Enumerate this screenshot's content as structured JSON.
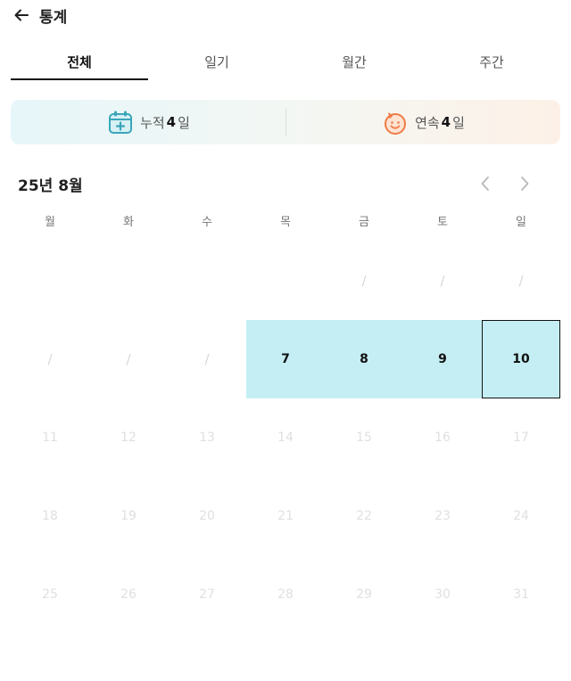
{
  "header": {
    "title": "통계"
  },
  "tabs": [
    {
      "label": "전체"
    },
    {
      "label": "일기"
    },
    {
      "label": "월간"
    },
    {
      "label": "주간"
    }
  ],
  "stats": {
    "cumulative": {
      "label": "누적",
      "value": "4",
      "unit": "일",
      "icon": "calendar-add-icon"
    },
    "streak": {
      "label": "연속",
      "value": "4",
      "unit": "일",
      "icon": "smiley-face-icon"
    }
  },
  "calendar": {
    "month_label": "25년 8월",
    "weekdays": [
      "월",
      "화",
      "수",
      "목",
      "금",
      "토",
      "일"
    ],
    "rows": [
      [
        "",
        "",
        "",
        "",
        "/",
        "/",
        "/"
      ],
      [
        "/",
        "/",
        "/",
        "7",
        "8",
        "9",
        "10"
      ],
      [
        "11",
        "12",
        "13",
        "14",
        "15",
        "16",
        "17"
      ],
      [
        "18",
        "19",
        "20",
        "21",
        "22",
        "23",
        "24"
      ],
      [
        "25",
        "26",
        "27",
        "28",
        "29",
        "30",
        "31"
      ]
    ],
    "active_days": [
      "7",
      "8",
      "9",
      "10"
    ],
    "today": "10"
  },
  "colors": {
    "highlight": "#c5eef4",
    "accent_teal": "#3aa6b9",
    "accent_orange": "#f07a45"
  }
}
